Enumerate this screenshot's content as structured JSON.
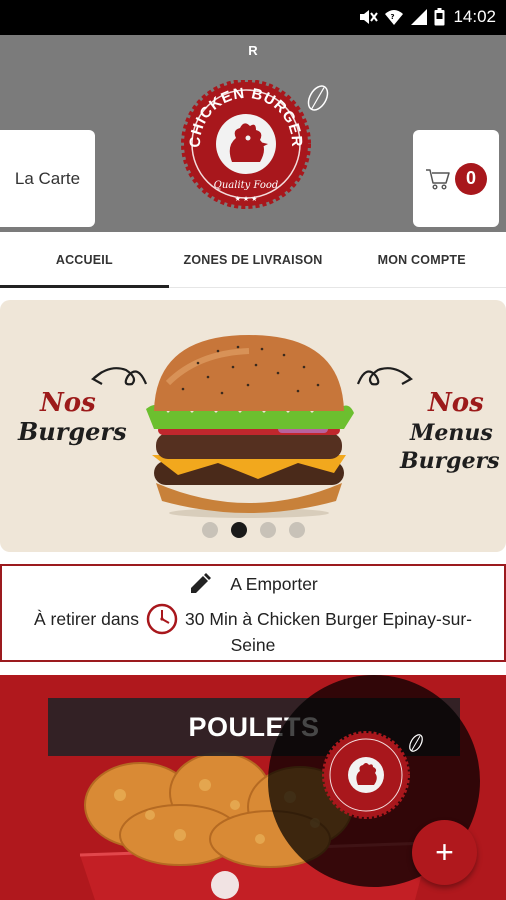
{
  "status_bar": {
    "time": "14:02",
    "icons": [
      "mute-icon",
      "wifi-icon",
      "signal-icon",
      "battery-icon"
    ]
  },
  "header": {
    "top_letter": "R",
    "menu_label": "La Carte",
    "cart_count": "0",
    "logo": {
      "brand": "CHICKEN BURGER",
      "tagline": "Quality Food"
    }
  },
  "tabs": [
    {
      "label": "ACCUEIL",
      "active": true
    },
    {
      "label": "ZONES DE LIVRAISON",
      "active": false
    },
    {
      "label": "MON COMPTE",
      "active": false
    }
  ],
  "carousel": {
    "left_title_1": "Nos",
    "left_title_2": "Burgers",
    "right_title_1": "Nos",
    "right_title_2": "Menus",
    "right_title_3": "Burgers",
    "slide_count": 4,
    "active_slide": 2
  },
  "delivery": {
    "mode": "A Emporter",
    "prefix": "À retirer dans",
    "line2_rest": "30 Min à Chicken Burger Epinay-sur-",
    "line3": "Seine"
  },
  "category": {
    "title": "POULETS"
  },
  "fab": {
    "label": "+"
  },
  "colors": {
    "brand_red": "#a8171c",
    "header_gray": "#7b7b7b",
    "carousel_bg": "#efe6d8"
  }
}
